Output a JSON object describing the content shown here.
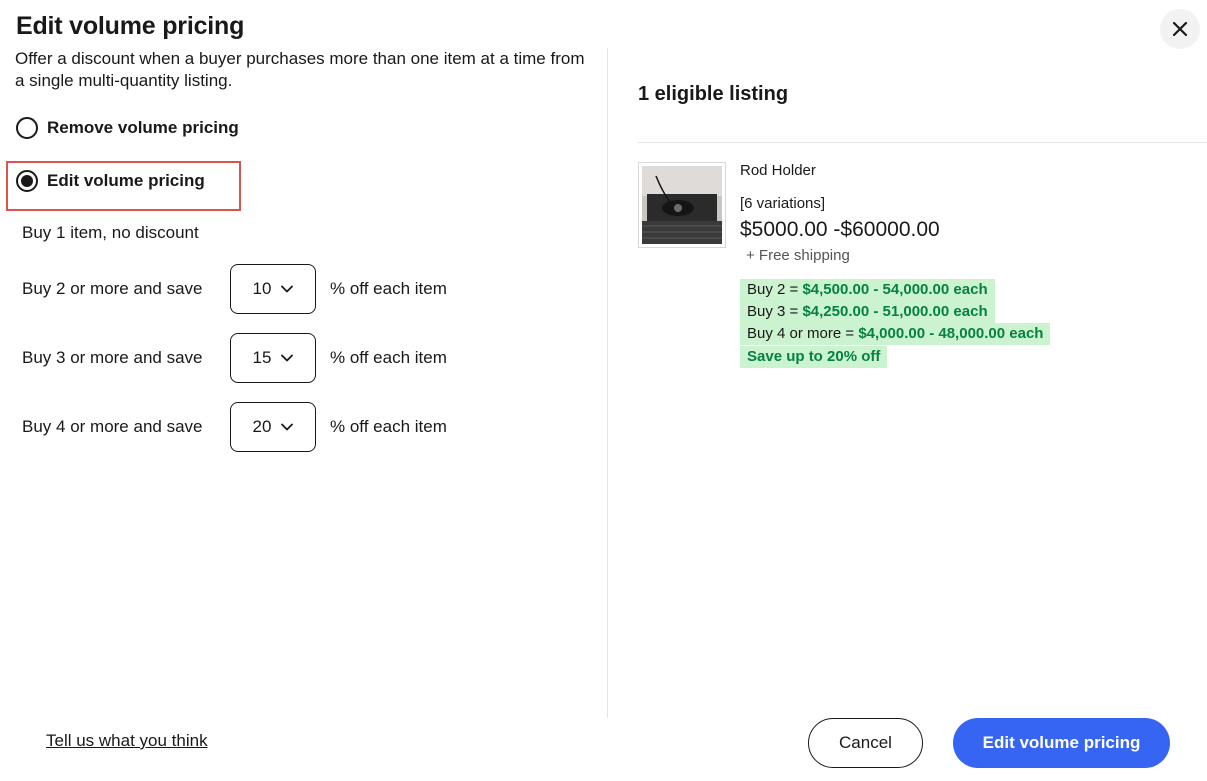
{
  "dialog": {
    "title": "Edit volume pricing",
    "close_icon": "close-icon",
    "intro": "Offer a discount when a buyer purchases more than one item at a time from a single multi-quantity listing."
  },
  "options": {
    "remove_label": "Remove volume pricing",
    "edit_label": "Edit volume pricing",
    "selected": "edit"
  },
  "tiers": {
    "no_discount": "Buy 1 item, no discount",
    "suffix": "% off each item",
    "items": [
      {
        "label": "Buy 2 or more and save",
        "value": "10"
      },
      {
        "label": "Buy 3 or more and save",
        "value": "15"
      },
      {
        "label": "Buy 4 or more and save",
        "value": "20"
      }
    ]
  },
  "listing": {
    "heading": "1 eligible listing",
    "title": "Rod Holder",
    "variations": "[6 variations]",
    "price": "$5000.00 -$60000.00",
    "shipping": "+ Free shipping",
    "deals": [
      {
        "prefix": "Buy 2 = ",
        "amount": "$4,500.00 - 54,000.00 each"
      },
      {
        "prefix": "Buy 3 = ",
        "amount": "$4,250.00 - 51,000.00 each"
      },
      {
        "prefix": "Buy 4 or more = ",
        "amount": "$4,000.00 - 48,000.00 each"
      }
    ],
    "save_text": "Save up to 20% off"
  },
  "footer": {
    "feedback_link": "Tell us what you think",
    "cancel_label": "Cancel",
    "submit_label": "Edit volume pricing"
  },
  "colors": {
    "primary": "#3665f3",
    "deal_bg": "#ccf3cf",
    "deal_text": "#05823f",
    "highlight": "#d9534f"
  }
}
